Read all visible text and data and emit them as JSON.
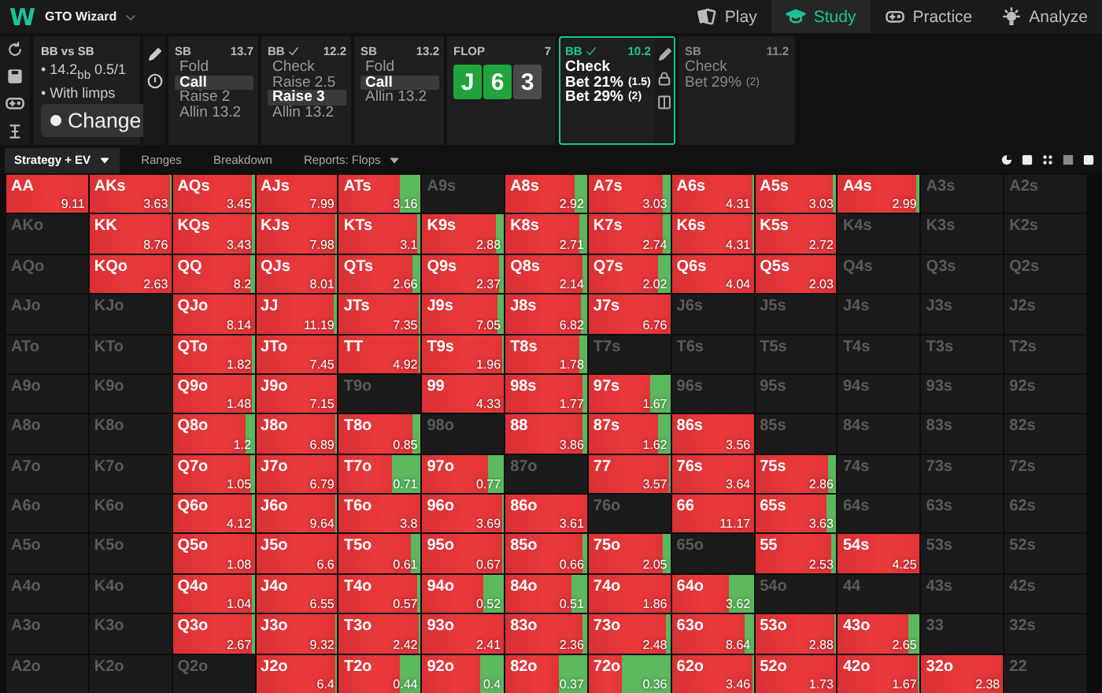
{
  "app": {
    "logo": "W",
    "name": "GTO Wizard"
  },
  "nav": [
    {
      "label": "Play",
      "selected": false
    },
    {
      "label": "Study",
      "selected": true
    },
    {
      "label": "Practice",
      "selected": false
    },
    {
      "label": "Analyze",
      "selected": false
    }
  ],
  "scenario": {
    "title": "BB vs SB",
    "details": [
      "• 14.2$_{bb}$ 0.5/1",
      "• With limps"
    ],
    "button": "Change"
  },
  "history": [
    {
      "player": "SB",
      "checked": false,
      "stack": "13.7",
      "options": [
        {
          "label": "Fold",
          "selected": false
        },
        {
          "label": "Call",
          "selected": true
        },
        {
          "label": "Raise 2",
          "selected": false
        },
        {
          "label": "Allin 13.2",
          "selected": false
        }
      ]
    },
    {
      "player": "BB",
      "checked": true,
      "stack": "12.2",
      "options": [
        {
          "label": "Check",
          "selected": false
        },
        {
          "label": "Raise 2.5",
          "selected": false
        },
        {
          "label": "Raise 3",
          "selected": true
        },
        {
          "label": "Allin 13.2",
          "selected": false
        }
      ]
    },
    {
      "player": "SB",
      "checked": false,
      "stack": "13.2",
      "options": [
        {
          "label": "Fold",
          "selected": false
        },
        {
          "label": "Call",
          "selected": true
        },
        {
          "label": "Allin 13.2",
          "selected": false
        }
      ]
    }
  ],
  "board": {
    "label": "FLOP",
    "count": "7",
    "cards": [
      {
        "rank": "J",
        "color": "#21a33b"
      },
      {
        "rank": "6",
        "color": "#21a33b"
      },
      {
        "rank": "3",
        "color": "#4a4a4a"
      }
    ]
  },
  "decisions": [
    {
      "player": "BB",
      "checked": true,
      "active": true,
      "stack": "10.2",
      "options": [
        {
          "label": "Check"
        },
        {
          "label": "Bet 21%",
          "amount": "(1.5)"
        },
        {
          "label": "Bet 29%",
          "amount": "(2)"
        }
      ]
    },
    {
      "player": "SB",
      "checked": false,
      "active": false,
      "stack": "11.2",
      "options": [
        {
          "label": "Check"
        },
        {
          "label": "Bet 29%",
          "amount": "(2)"
        }
      ]
    }
  ],
  "tabs": [
    {
      "label": "Strategy + EV",
      "selected": true,
      "dropdown": true
    },
    {
      "label": "Ranges",
      "selected": false,
      "dropdown": false
    },
    {
      "label": "Breakdown",
      "selected": false,
      "dropdown": false
    },
    {
      "label": "Reports: Flops",
      "selected": false,
      "dropdown": true
    }
  ],
  "hand_matrix": {
    "rows": [
      [
        {
          "hand": "AA",
          "in_range": true,
          "ev": "9.11",
          "level": 1
        },
        {
          "hand": "AKs",
          "in_range": true,
          "ev": "3.63",
          "level": 0.98
        },
        {
          "hand": "AQs",
          "in_range": true,
          "ev": "3.45",
          "level": 0.98
        },
        {
          "hand": "AJs",
          "in_range": true,
          "ev": "7.99",
          "level": 1
        },
        {
          "hand": "ATs",
          "in_range": true,
          "ev": "3.16",
          "level": 0.75
        },
        {
          "hand": "A9s",
          "in_range": false
        },
        {
          "hand": "A8s",
          "in_range": true,
          "ev": "2.92",
          "level": 0.85
        },
        {
          "hand": "A7s",
          "in_range": true,
          "ev": "3.03",
          "level": 0.9
        },
        {
          "hand": "A6s",
          "in_range": true,
          "ev": "4.31",
          "level": 0.98
        },
        {
          "hand": "A5s",
          "in_range": true,
          "ev": "3.03",
          "level": 0.96
        },
        {
          "hand": "A4s",
          "in_range": true,
          "ev": "2.99",
          "level": 0.96
        },
        {
          "hand": "A3s",
          "in_range": false
        },
        {
          "hand": "A2s",
          "in_range": false
        }
      ],
      [
        {
          "hand": "AKo",
          "in_range": false
        },
        {
          "hand": "KK",
          "in_range": true,
          "ev": "8.76",
          "level": 1
        },
        {
          "hand": "KQs",
          "in_range": true,
          "ev": "3.43",
          "level": 0.98
        },
        {
          "hand": "KJs",
          "in_range": true,
          "ev": "7.98",
          "level": 0.98
        },
        {
          "hand": "KTs",
          "in_range": true,
          "ev": "3.1",
          "level": 0.95
        },
        {
          "hand": "K9s",
          "in_range": true,
          "ev": "2.88",
          "level": 0.9
        },
        {
          "hand": "K8s",
          "in_range": true,
          "ev": "2.71",
          "level": 0.9
        },
        {
          "hand": "K7s",
          "in_range": true,
          "ev": "2.74",
          "level": 0.9
        },
        {
          "hand": "K6s",
          "in_range": true,
          "ev": "4.31",
          "level": 0.98
        },
        {
          "hand": "K5s",
          "in_range": true,
          "ev": "2.72",
          "level": 1
        },
        {
          "hand": "K4s",
          "in_range": false
        },
        {
          "hand": "K3s",
          "in_range": false
        },
        {
          "hand": "K2s",
          "in_range": false
        }
      ],
      [
        {
          "hand": "AQo",
          "in_range": false
        },
        {
          "hand": "KQo",
          "in_range": true,
          "ev": "2.63",
          "level": 1
        },
        {
          "hand": "QQ",
          "in_range": true,
          "ev": "8.2",
          "level": 0.95
        },
        {
          "hand": "QJs",
          "in_range": true,
          "ev": "8.01",
          "level": 0.98
        },
        {
          "hand": "QTs",
          "in_range": true,
          "ev": "2.66",
          "level": 0.9
        },
        {
          "hand": "Q9s",
          "in_range": true,
          "ev": "2.37",
          "level": 0.95
        },
        {
          "hand": "Q8s",
          "in_range": true,
          "ev": "2.14",
          "level": 0.95
        },
        {
          "hand": "Q7s",
          "in_range": true,
          "ev": "2.02",
          "level": 0.85
        },
        {
          "hand": "Q6s",
          "in_range": true,
          "ev": "4.04",
          "level": 1
        },
        {
          "hand": "Q5s",
          "in_range": true,
          "ev": "2.03",
          "level": 1
        },
        {
          "hand": "Q4s",
          "in_range": false
        },
        {
          "hand": "Q3s",
          "in_range": false
        },
        {
          "hand": "Q2s",
          "in_range": false
        }
      ],
      [
        {
          "hand": "AJo",
          "in_range": false
        },
        {
          "hand": "KJo",
          "in_range": false
        },
        {
          "hand": "QJo",
          "in_range": true,
          "ev": "8.14",
          "level": 1
        },
        {
          "hand": "JJ",
          "in_range": true,
          "ev": "11.19",
          "level": 0.95
        },
        {
          "hand": "JTs",
          "in_range": true,
          "ev": "7.35",
          "level": 0.98
        },
        {
          "hand": "J9s",
          "in_range": true,
          "ev": "7.05",
          "level": 0.92
        },
        {
          "hand": "J8s",
          "in_range": true,
          "ev": "6.82",
          "level": 0.93
        },
        {
          "hand": "J7s",
          "in_range": true,
          "ev": "6.76",
          "level": 1
        },
        {
          "hand": "J6s",
          "in_range": false
        },
        {
          "hand": "J5s",
          "in_range": false
        },
        {
          "hand": "J4s",
          "in_range": false
        },
        {
          "hand": "J3s",
          "in_range": false
        },
        {
          "hand": "J2s",
          "in_range": false
        }
      ],
      [
        {
          "hand": "ATo",
          "in_range": false
        },
        {
          "hand": "KTo",
          "in_range": false
        },
        {
          "hand": "QTo",
          "in_range": true,
          "ev": "1.82",
          "level": 0.98
        },
        {
          "hand": "JTo",
          "in_range": true,
          "ev": "7.45",
          "level": 1
        },
        {
          "hand": "TT",
          "in_range": true,
          "ev": "4.92",
          "level": 0.98
        },
        {
          "hand": "T9s",
          "in_range": true,
          "ev": "1.96",
          "level": 0.98
        },
        {
          "hand": "T8s",
          "in_range": true,
          "ev": "1.78",
          "level": 0.9
        },
        {
          "hand": "T7s",
          "in_range": false
        },
        {
          "hand": "T6s",
          "in_range": false
        },
        {
          "hand": "T5s",
          "in_range": false
        },
        {
          "hand": "T4s",
          "in_range": false
        },
        {
          "hand": "T3s",
          "in_range": false
        },
        {
          "hand": "T2s",
          "in_range": false
        }
      ],
      [
        {
          "hand": "A9o",
          "in_range": false
        },
        {
          "hand": "K9o",
          "in_range": false
        },
        {
          "hand": "Q9o",
          "in_range": true,
          "ev": "1.48",
          "level": 0.98
        },
        {
          "hand": "J9o",
          "in_range": true,
          "ev": "7.15",
          "level": 1
        },
        {
          "hand": "T9o",
          "in_range": false
        },
        {
          "hand": "99",
          "in_range": true,
          "ev": "4.33",
          "level": 1
        },
        {
          "hand": "98s",
          "in_range": true,
          "ev": "1.77",
          "level": 0.95
        },
        {
          "hand": "97s",
          "in_range": true,
          "ev": "1.67",
          "level": 0.75
        },
        {
          "hand": "96s",
          "in_range": false
        },
        {
          "hand": "95s",
          "in_range": false
        },
        {
          "hand": "94s",
          "in_range": false
        },
        {
          "hand": "93s",
          "in_range": false
        },
        {
          "hand": "92s",
          "in_range": false
        }
      ],
      [
        {
          "hand": "A8o",
          "in_range": false
        },
        {
          "hand": "K8o",
          "in_range": false
        },
        {
          "hand": "Q8o",
          "in_range": true,
          "ev": "1.2",
          "level": 0.9
        },
        {
          "hand": "J8o",
          "in_range": true,
          "ev": "6.89",
          "level": 0.98
        },
        {
          "hand": "T8o",
          "in_range": true,
          "ev": "0.85",
          "level": 0.9
        },
        {
          "hand": "98o",
          "in_range": false
        },
        {
          "hand": "88",
          "in_range": true,
          "ev": "3.86",
          "level": 0.95
        },
        {
          "hand": "87s",
          "in_range": true,
          "ev": "1.62",
          "level": 0.85
        },
        {
          "hand": "86s",
          "in_range": true,
          "ev": "3.56",
          "level": 1
        },
        {
          "hand": "85s",
          "in_range": false
        },
        {
          "hand": "84s",
          "in_range": false
        },
        {
          "hand": "83s",
          "in_range": false
        },
        {
          "hand": "82s",
          "in_range": false
        }
      ],
      [
        {
          "hand": "A7o",
          "in_range": false
        },
        {
          "hand": "K7o",
          "in_range": false
        },
        {
          "hand": "Q7o",
          "in_range": true,
          "ev": "1.05",
          "level": 0.95
        },
        {
          "hand": "J7o",
          "in_range": true,
          "ev": "6.79",
          "level": 1
        },
        {
          "hand": "T7o",
          "in_range": true,
          "ev": "0.71",
          "level": 0.65
        },
        {
          "hand": "97o",
          "in_range": true,
          "ev": "0.77",
          "level": 0.8
        },
        {
          "hand": "87o",
          "in_range": false
        },
        {
          "hand": "77",
          "in_range": true,
          "ev": "3.57",
          "level": 0.98
        },
        {
          "hand": "76s",
          "in_range": true,
          "ev": "3.64",
          "level": 1
        },
        {
          "hand": "75s",
          "in_range": true,
          "ev": "2.86",
          "level": 0.9
        },
        {
          "hand": "74s",
          "in_range": false
        },
        {
          "hand": "73s",
          "in_range": false
        },
        {
          "hand": "72s",
          "in_range": false
        }
      ],
      [
        {
          "hand": "A6o",
          "in_range": false
        },
        {
          "hand": "K6o",
          "in_range": false
        },
        {
          "hand": "Q6o",
          "in_range": true,
          "ev": "4.12",
          "level": 0.98
        },
        {
          "hand": "J6o",
          "in_range": true,
          "ev": "9.64",
          "level": 0.98
        },
        {
          "hand": "T6o",
          "in_range": true,
          "ev": "3.8",
          "level": 1
        },
        {
          "hand": "96o",
          "in_range": true,
          "ev": "3.69",
          "level": 0.98
        },
        {
          "hand": "86o",
          "in_range": true,
          "ev": "3.61",
          "level": 1
        },
        {
          "hand": "76o",
          "in_range": false
        },
        {
          "hand": "66",
          "in_range": true,
          "ev": "11.17",
          "level": 1
        },
        {
          "hand": "65s",
          "in_range": true,
          "ev": "3.63",
          "level": 0.88
        },
        {
          "hand": "64s",
          "in_range": false
        },
        {
          "hand": "63s",
          "in_range": false
        },
        {
          "hand": "62s",
          "in_range": false
        }
      ],
      [
        {
          "hand": "A5o",
          "in_range": false
        },
        {
          "hand": "K5o",
          "in_range": false
        },
        {
          "hand": "Q5o",
          "in_range": true,
          "ev": "1.08",
          "level": 1
        },
        {
          "hand": "J5o",
          "in_range": true,
          "ev": "6.6",
          "level": 1
        },
        {
          "hand": "T5o",
          "in_range": true,
          "ev": "0.61",
          "level": 0.88
        },
        {
          "hand": "95o",
          "in_range": true,
          "ev": "0.67",
          "level": 0.98
        },
        {
          "hand": "85o",
          "in_range": true,
          "ev": "0.66",
          "level": 0.95
        },
        {
          "hand": "75o",
          "in_range": true,
          "ev": "2.05",
          "level": 0.9
        },
        {
          "hand": "65o",
          "in_range": false
        },
        {
          "hand": "55",
          "in_range": true,
          "ev": "2.53",
          "level": 0.93
        },
        {
          "hand": "54s",
          "in_range": true,
          "ev": "4.25",
          "level": 1
        },
        {
          "hand": "53s",
          "in_range": false
        },
        {
          "hand": "52s",
          "in_range": false
        }
      ],
      [
        {
          "hand": "A4o",
          "in_range": false
        },
        {
          "hand": "K4o",
          "in_range": false
        },
        {
          "hand": "Q4o",
          "in_range": true,
          "ev": "1.04",
          "level": 0.98
        },
        {
          "hand": "J4o",
          "in_range": true,
          "ev": "6.55",
          "level": 1
        },
        {
          "hand": "T4o",
          "in_range": true,
          "ev": "0.57",
          "level": 0.95
        },
        {
          "hand": "94o",
          "in_range": true,
          "ev": "0.52",
          "level": 0.75
        },
        {
          "hand": "84o",
          "in_range": true,
          "ev": "0.51",
          "level": 0.8
        },
        {
          "hand": "74o",
          "in_range": true,
          "ev": "1.86",
          "level": 1
        },
        {
          "hand": "64o",
          "in_range": true,
          "ev": "3.62",
          "level": 0.7
        },
        {
          "hand": "54o",
          "in_range": false
        },
        {
          "hand": "44",
          "in_range": false
        },
        {
          "hand": "43s",
          "in_range": false
        },
        {
          "hand": "42s",
          "in_range": false
        }
      ],
      [
        {
          "hand": "A3o",
          "in_range": false
        },
        {
          "hand": "K3o",
          "in_range": false
        },
        {
          "hand": "Q3o",
          "in_range": true,
          "ev": "2.67",
          "level": 0.98
        },
        {
          "hand": "J3o",
          "in_range": true,
          "ev": "9.32",
          "level": 0.98
        },
        {
          "hand": "T3o",
          "in_range": true,
          "ev": "2.42",
          "level": 0.98
        },
        {
          "hand": "93o",
          "in_range": true,
          "ev": "2.41",
          "level": 1
        },
        {
          "hand": "83o",
          "in_range": true,
          "ev": "2.36",
          "level": 0.95
        },
        {
          "hand": "73o",
          "in_range": true,
          "ev": "2.48",
          "level": 0.95
        },
        {
          "hand": "63o",
          "in_range": true,
          "ev": "8.64",
          "level": 0.9
        },
        {
          "hand": "53o",
          "in_range": true,
          "ev": "2.88",
          "level": 0.98
        },
        {
          "hand": "43o",
          "in_range": true,
          "ev": "2.65",
          "level": 0.85
        },
        {
          "hand": "33",
          "in_range": false
        },
        {
          "hand": "32s",
          "in_range": false
        }
      ],
      [
        {
          "hand": "A2o",
          "in_range": false
        },
        {
          "hand": "K2o",
          "in_range": false
        },
        {
          "hand": "Q2o",
          "in_range": false
        },
        {
          "hand": "J2o",
          "in_range": true,
          "ev": "6.4",
          "level": 0.98
        },
        {
          "hand": "T2o",
          "in_range": true,
          "ev": "0.44",
          "level": 0.75
        },
        {
          "hand": "92o",
          "in_range": true,
          "ev": "0.4",
          "level": 0.7
        },
        {
          "hand": "82o",
          "in_range": true,
          "ev": "0.37",
          "level": 0.65
        },
        {
          "hand": "72o",
          "in_range": true,
          "ev": "0.36",
          "level": 0.4
        },
        {
          "hand": "62o",
          "in_range": true,
          "ev": "3.46",
          "level": 0.98
        },
        {
          "hand": "52o",
          "in_range": true,
          "ev": "1.73",
          "level": 1
        },
        {
          "hand": "42o",
          "in_range": true,
          "ev": "1.67",
          "level": 0.98
        },
        {
          "hand": "32o",
          "in_range": true,
          "ev": "2.38",
          "level": 1
        },
        {
          "hand": "22",
          "in_range": false
        }
      ]
    ]
  }
}
